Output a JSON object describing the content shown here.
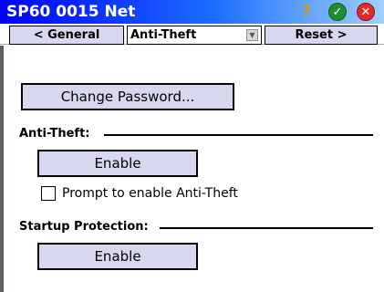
{
  "window": {
    "title": "SP60 0015 Net",
    "icons": [
      "help-icon",
      "ok-icon",
      "close-icon"
    ],
    "colors": {
      "titlebar_start": "#0000ff",
      "titlebar_end": "#9fd0ff",
      "button_fill": "#d7d7ef"
    }
  },
  "nav": {
    "prev_label": "< General",
    "current_page": "Anti-Theft",
    "next_label": "Reset >"
  },
  "content": {
    "change_password_label": "Change Password...",
    "anti_theft": {
      "section_title": "Anti-Theft:",
      "enable_label": "Enable",
      "prompt_label": "Prompt to enable Anti-Theft",
      "prompt_checked": false
    },
    "startup_protection": {
      "section_title": "Startup Protection:",
      "enable_label": "Enable"
    }
  }
}
